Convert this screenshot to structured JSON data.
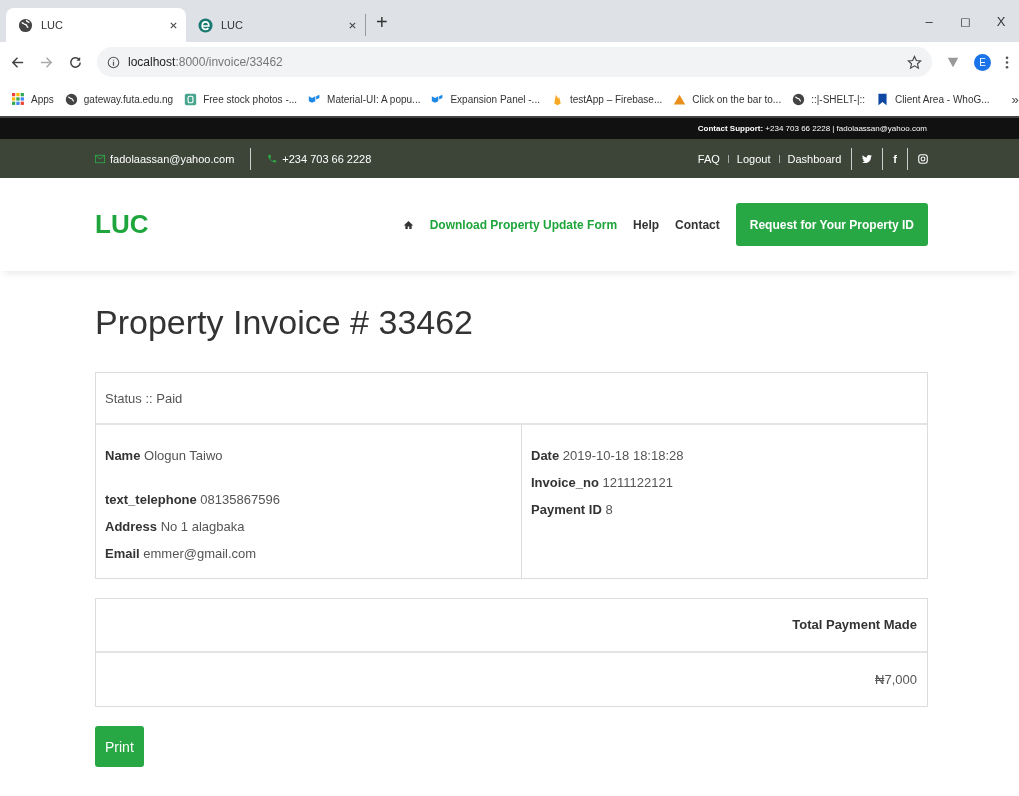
{
  "browser": {
    "tabs": [
      {
        "title": "LUC",
        "kind": "globe",
        "selected": true
      },
      {
        "title": "LUC",
        "kind": "edge",
        "selected": false
      }
    ],
    "new_tab": "+",
    "window_controls": [
      "–",
      "◻",
      "X"
    ],
    "address": {
      "host": "localhost",
      "path": ":8000/invoice/33462"
    },
    "profile": "E",
    "bookmarks": [
      {
        "label": "Apps",
        "kind": "apps"
      },
      {
        "label": "gateway.futa.edu.ng",
        "kind": "globe"
      },
      {
        "label": "Free stock photos -...",
        "kind": "square"
      },
      {
        "label": "Material-UI: A popu...",
        "kind": "mui"
      },
      {
        "label": "Expansion Panel -...",
        "kind": "mui"
      },
      {
        "label": "testApp – Firebase...",
        "kind": "flame"
      },
      {
        "label": "Click on the bar to...",
        "kind": "pyramid"
      },
      {
        "label": "::|-SHELT-|::",
        "kind": "globe"
      },
      {
        "label": "Client Area - WhoG...",
        "kind": "bookmark"
      }
    ],
    "more": "»"
  },
  "support_bar": {
    "label": "Contact Support:",
    "text": " +234 703 66 2228 | fadolaassan@yahoo.com"
  },
  "top_bar": {
    "email": "fadolaassan@yahoo.com",
    "phone": "+234 703 66 2228",
    "links": [
      "FAQ",
      "Logout",
      "Dashboard"
    ],
    "social": [
      {
        "kind": "twitter"
      },
      {
        "kind": "facebook",
        "text": "f"
      },
      {
        "kind": "instagram"
      }
    ]
  },
  "header": {
    "logo": "LUC",
    "nav": [
      {
        "label": "Download Property Update Form",
        "highlighted": true
      },
      {
        "label": "Help",
        "highlighted": false
      },
      {
        "label": "Contact",
        "highlighted": false
      }
    ],
    "cta": "Request for Your Property ID"
  },
  "invoice": {
    "title": "Property Invoice # 33462",
    "status": "Status :: Paid",
    "left": [
      "**Name** Ologun Taiwo",
      "**text_telephone** 08135867596",
      "**Address** No 1 alagbaka",
      "**Email** emmer@gmail.com"
    ],
    "right": [
      "**Date** 2019-10-18 18:18:28",
      "**Invoice_no** 1211122121",
      "**Payment ID** 8"
    ],
    "total_heading": "Total Payment Made",
    "total": "₦7,000",
    "print": "Print"
  }
}
